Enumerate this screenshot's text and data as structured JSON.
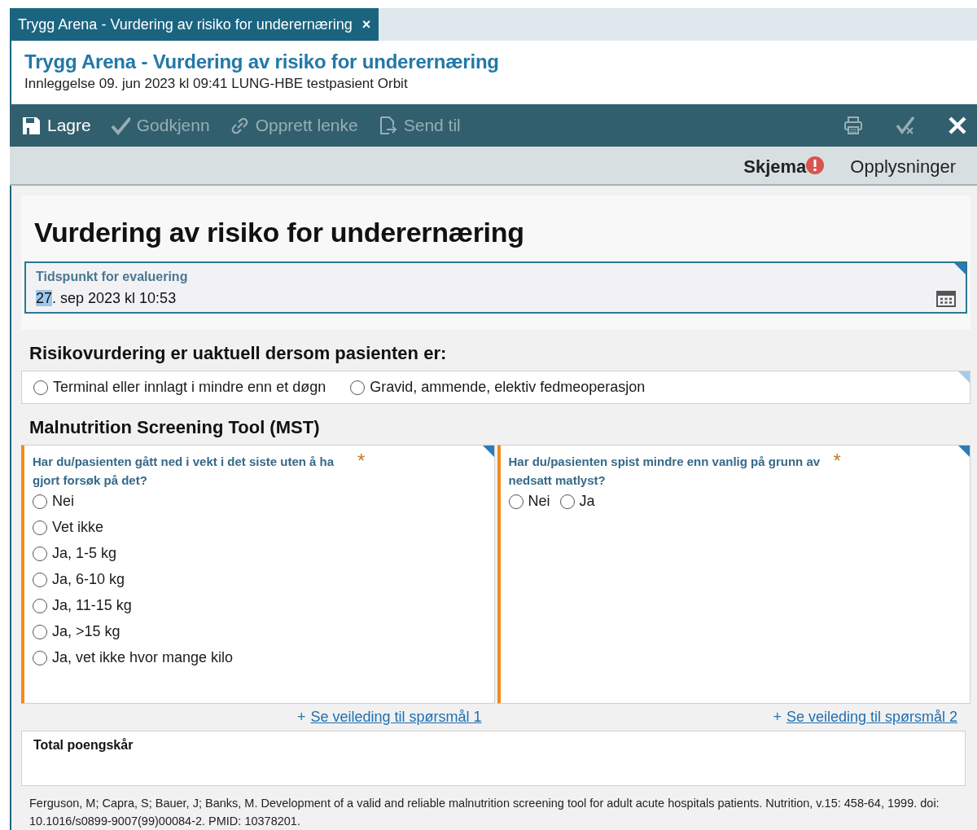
{
  "tab": {
    "label": "Trygg Arena - Vurdering av risiko for underernæring",
    "close": "×",
    "selected": true
  },
  "header": {
    "title": "Trygg Arena - Vurdering av risiko for underernæring",
    "subtitle": "Innleggelse 09. jun 2023 kl 09:41 LUNG-HBE testpasient Orbit"
  },
  "toolbar": {
    "buttons": [
      {
        "kind": "save",
        "label": "Lagre",
        "disabled": false
      },
      {
        "kind": "approve",
        "label": "Godkjenn",
        "disabled": true
      },
      {
        "kind": "link",
        "label": "Opprett lenke",
        "disabled": true
      },
      {
        "kind": "send",
        "label": "Send til",
        "disabled": true
      }
    ],
    "icons": [
      {
        "kind": "print",
        "disabled": true
      },
      {
        "kind": "sign",
        "disabled": true
      },
      {
        "kind": "close",
        "disabled": false
      }
    ]
  },
  "view_tabs": [
    {
      "label": "Skjema",
      "selected": true,
      "error": true
    },
    {
      "label": "Opplysninger",
      "selected": false,
      "error": false
    }
  ],
  "form": {
    "title": "Vurdering av risiko for underernæring",
    "date_field": {
      "label": "Tidspunkt for evaluering",
      "value_selected": "27",
      "value_rest": ". sep 2023 kl 10:53"
    },
    "exclusion": {
      "heading": "Risikovurdering er uaktuell dersom pasienten er:",
      "options": [
        {
          "label": "Terminal eller innlagt i mindre enn et døgn",
          "selected": false
        },
        {
          "label": "Gravid, ammende, elektiv fedmeoperasjon",
          "selected": false
        }
      ]
    },
    "mst": {
      "heading": "Malnutrition Screening Tool (MST)",
      "questions": [
        {
          "text": "Har du/pasienten gått ned i vekt i det siste uten å ha gjort forsøk på det?",
          "required_mark": "*",
          "kind": "list",
          "options": [
            {
              "label": "Nei",
              "selected": false
            },
            {
              "label": "Vet ikke",
              "selected": false
            },
            {
              "label": "Ja, 1-5 kg",
              "selected": false
            },
            {
              "label": "Ja, 6-10 kg",
              "selected": false
            },
            {
              "label": "Ja, 11-15 kg",
              "selected": false
            },
            {
              "label": "Ja, >15 kg",
              "selected": false
            },
            {
              "label": "Ja, vet ikke hvor mange kilo",
              "selected": false
            }
          ],
          "guide_prefix": "+",
          "guide_link": "Se veileding til spørsmål 1"
        },
        {
          "text": "Har du/pasienten spist mindre enn vanlig på grunn av nedsatt matlyst?",
          "required_mark": "*",
          "kind": "inline",
          "options": [
            {
              "label": "Nei",
              "selected": false
            },
            {
              "label": "Ja",
              "selected": false
            }
          ],
          "guide_prefix": "+",
          "guide_link": "Se veileding til spørsmål 2"
        }
      ]
    },
    "total": {
      "label": "Total poengskår"
    },
    "citation": "Ferguson, M; Capra, S; Bauer, J; Banks, M. Development of a valid and reliable malnutrition screening tool for adult acute hospitals patients. Nutrition, v.15: 458-64, 1999. doi: 10.1016/s0899-9007(99)00084-2. PMID: 10378201."
  }
}
